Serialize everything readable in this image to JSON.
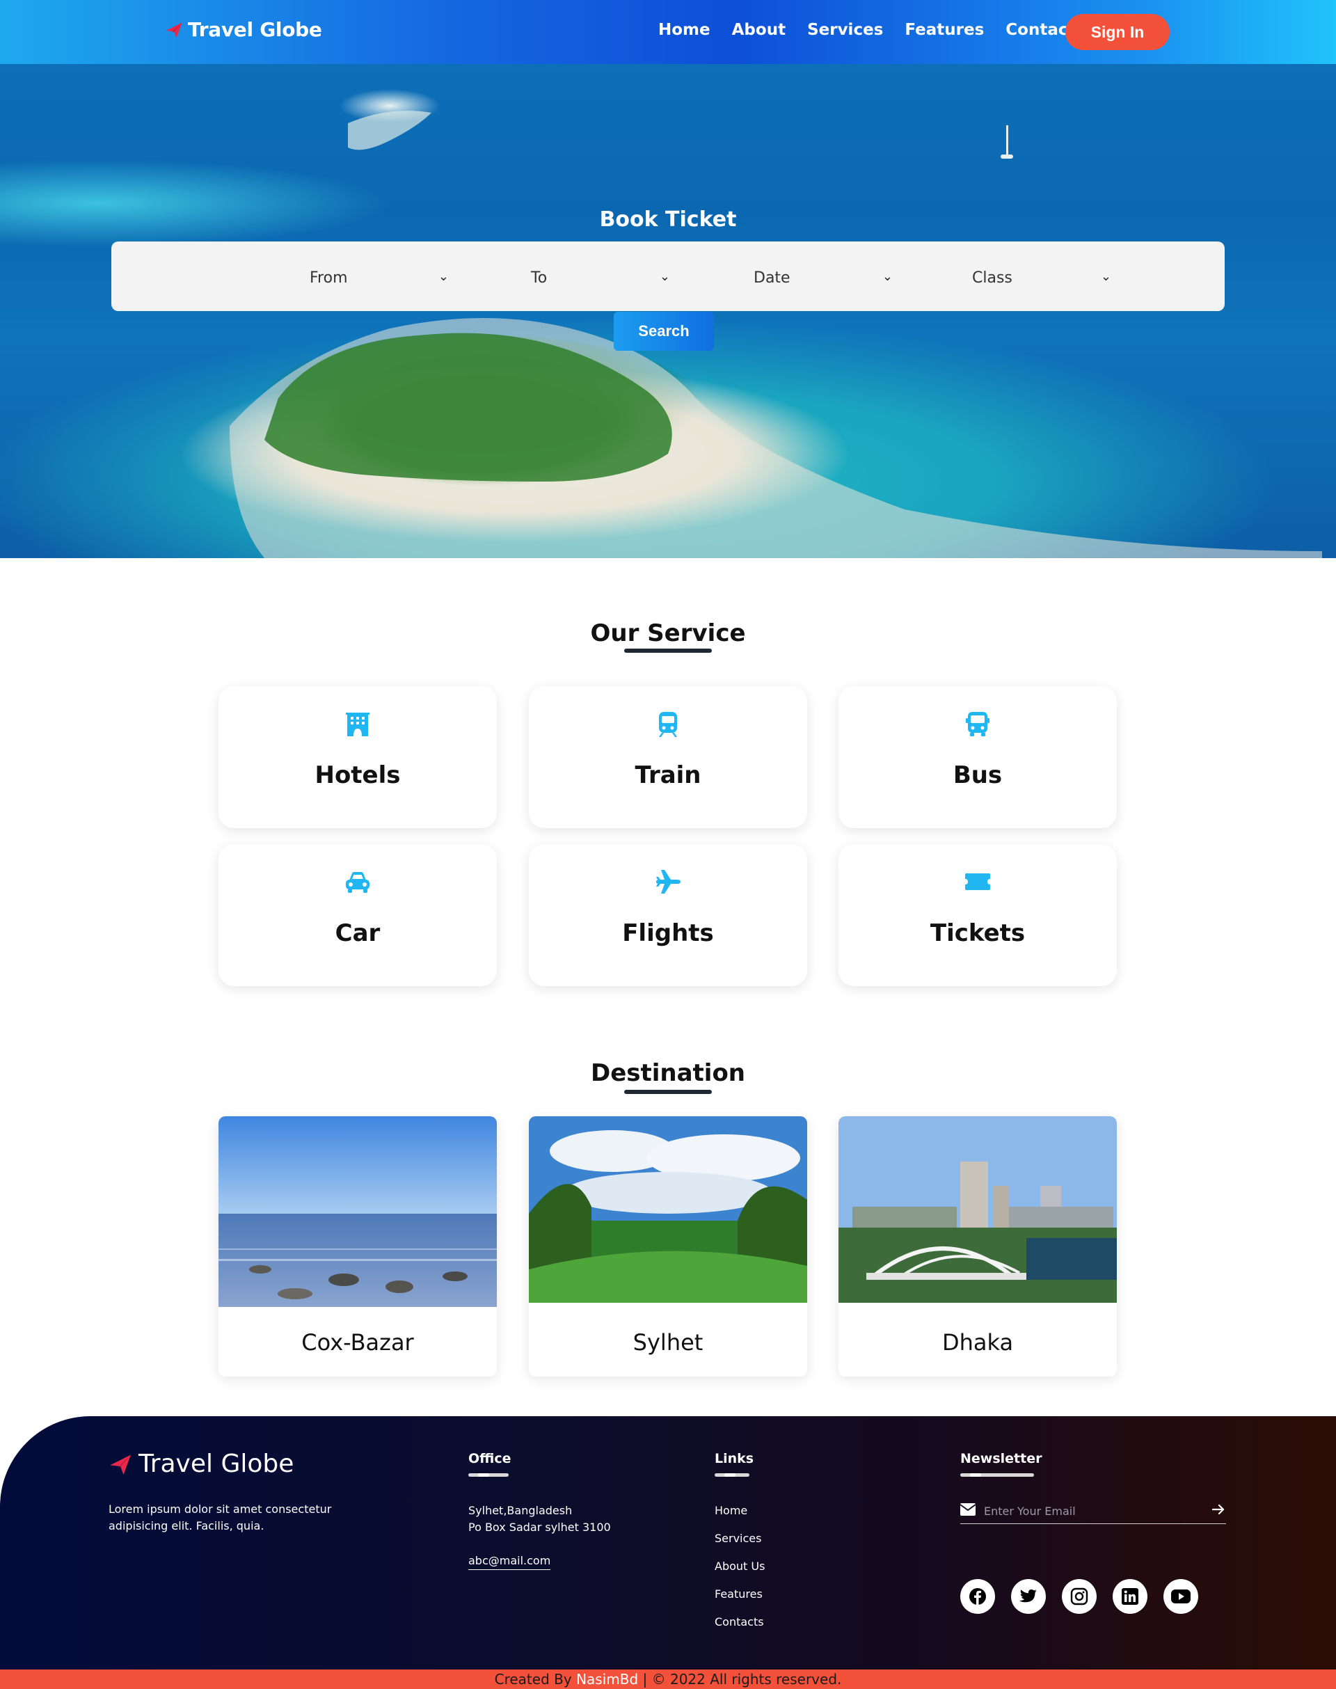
{
  "nav": {
    "brand": "Travel Globe",
    "links": [
      "Home",
      "About",
      "Services",
      "Features",
      "Contact"
    ],
    "signin": "Sign In"
  },
  "hero": {
    "title": "Book Ticket",
    "fields": [
      "From",
      "To",
      "Date",
      "Class"
    ],
    "search": "Search"
  },
  "services": {
    "title": "Our Service",
    "items": [
      {
        "label": "Hotels",
        "icon": "hotel-icon"
      },
      {
        "label": "Train",
        "icon": "train-icon"
      },
      {
        "label": "Bus",
        "icon": "bus-icon"
      },
      {
        "label": "Car",
        "icon": "car-icon"
      },
      {
        "label": "Flights",
        "icon": "plane-icon"
      },
      {
        "label": "Tickets",
        "icon": "ticket-icon"
      }
    ]
  },
  "destinations": {
    "title": "Destination",
    "items": [
      {
        "label": "Cox-Bazar"
      },
      {
        "label": "Sylhet"
      },
      {
        "label": "Dhaka"
      }
    ]
  },
  "footer": {
    "brand": "Travel Globe",
    "description": "Lorem ipsum dolor sit amet consectetur adipisicing elit. Facilis, quia.",
    "office_heading": "Office",
    "office_line1": "Sylhet,Bangladesh",
    "office_line2": "Po Box Sadar sylhet 3100",
    "office_email": "abc@mail.com",
    "links_heading": "Links",
    "links": [
      "Home",
      "Services",
      "About Us",
      "Features",
      "Contacts"
    ],
    "newsletter_heading": "Newsletter",
    "newsletter_placeholder": "Enter Your Email",
    "social": [
      "facebook-icon",
      "twitter-icon",
      "instagram-icon",
      "linkedin-icon",
      "youtube-icon"
    ]
  },
  "copyright": {
    "prefix": "Created By",
    "author": "NasimBd",
    "suffix": "| © 2022 All rights reserved."
  },
  "colors": {
    "accent": "#f4513b",
    "icon_blue": "#1fb6f2",
    "nav_blue": "#1565e0",
    "footer_dark": "#020b3a"
  }
}
